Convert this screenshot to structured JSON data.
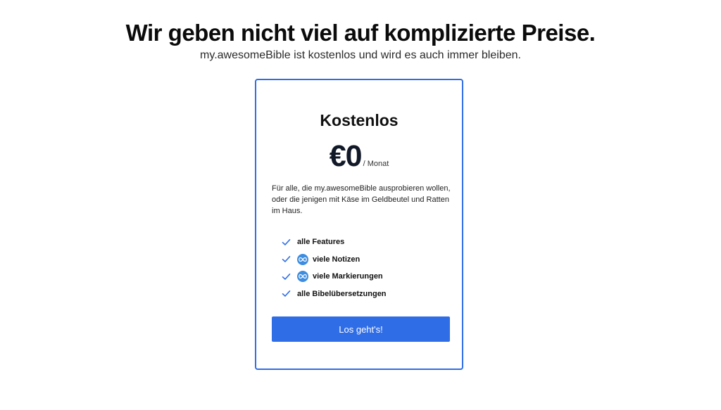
{
  "header": {
    "title": "Wir geben nicht viel auf komplizierte Preise.",
    "subtitle": "my.awesomeBible ist kostenlos und wird es auch immer bleiben."
  },
  "plan": {
    "name": "Kostenlos",
    "price": "€0",
    "period": "/ Monat",
    "description": "Für alle, die my.awesomeBible ausprobieren wollen, oder die jenigen mit Käse im Geldbeutel und Ratten im Haus.",
    "features": [
      {
        "label": "alle Features",
        "icon": "check-icon",
        "badge": null
      },
      {
        "label": "viele Notizen",
        "icon": "check-icon",
        "badge": "infinity-icon"
      },
      {
        "label": "viele Markierungen",
        "icon": "check-icon",
        "badge": "infinity-icon"
      },
      {
        "label": "alle Bibelübersetzungen",
        "icon": "check-icon",
        "badge": null
      }
    ],
    "cta_label": "Los geht's!"
  },
  "colors": {
    "accent": "#2f6de6",
    "badge": "#3d8de0",
    "text": "#111111"
  }
}
